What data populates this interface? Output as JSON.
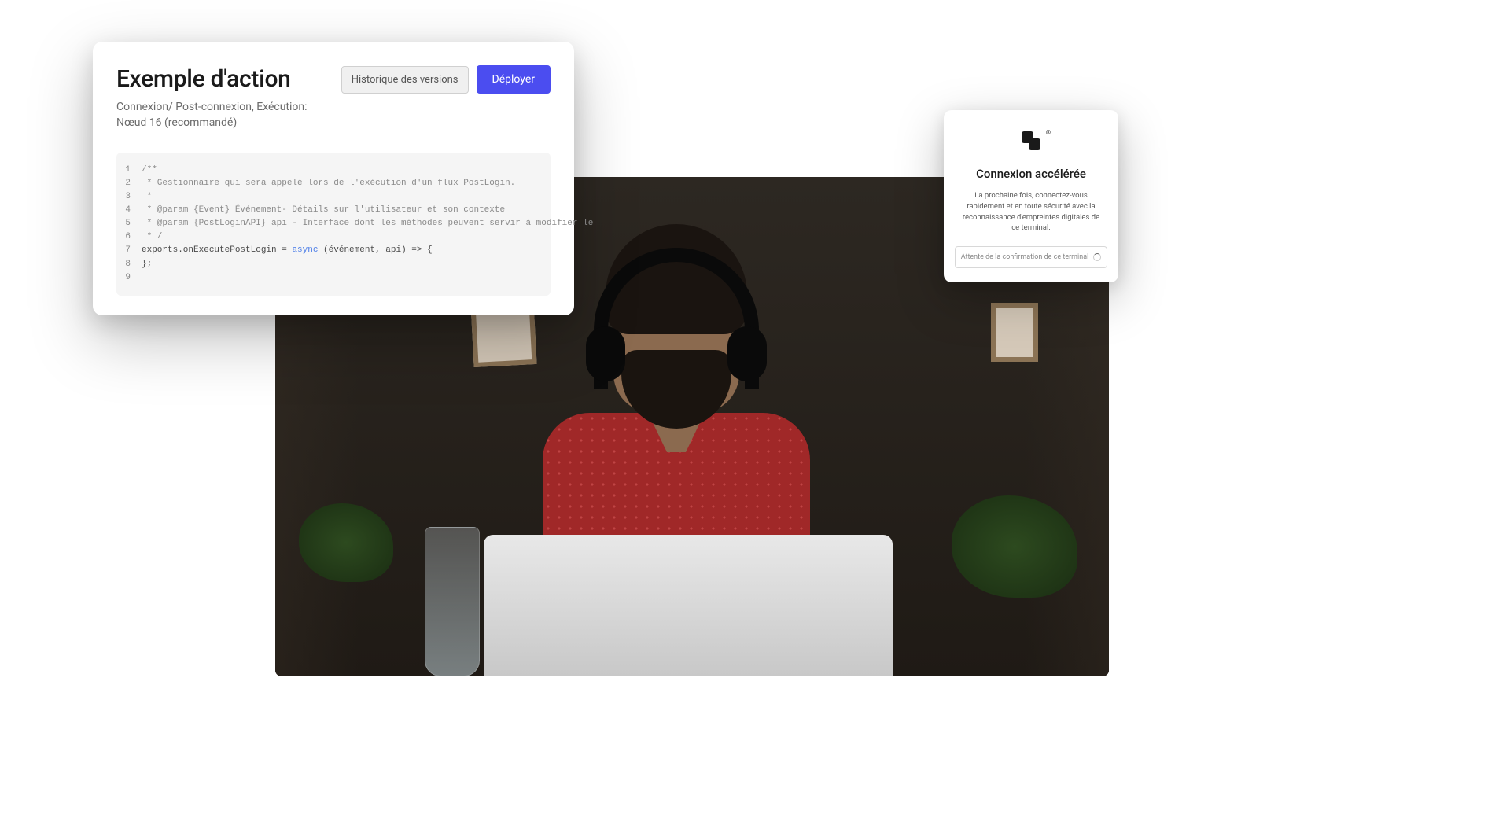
{
  "code_card": {
    "title": "Exemple d'action",
    "subtitle": "Connexion/ Post-connexion, Exécution: Nœud 16 (recommandé)",
    "buttons": {
      "history": "Historique des versions",
      "deploy": "Déployer"
    },
    "code": {
      "lines": [
        {
          "num": "1",
          "segments": [
            {
              "t": "/**",
              "c": "comment"
            }
          ]
        },
        {
          "num": "2",
          "segments": [
            {
              "t": " * Gestionnaire qui sera appelé lors de l'exécution d'un flux PostLogin.",
              "c": "comment"
            }
          ]
        },
        {
          "num": "3",
          "segments": [
            {
              "t": " *",
              "c": "comment"
            }
          ]
        },
        {
          "num": "4",
          "segments": [
            {
              "t": " * @param {Event} Événement- Détails sur l'utilisateur et son contexte",
              "c": "comment"
            }
          ]
        },
        {
          "num": "5",
          "segments": [
            {
              "t": " * @param {PostLoginAPI} api - Interface dont les méthodes peuvent servir à modifier le",
              "c": "comment"
            }
          ]
        },
        {
          "num": "6",
          "segments": [
            {
              "t": " * /",
              "c": "comment"
            }
          ]
        },
        {
          "num": "7",
          "segments": [
            {
              "t": "exports.onExecutePostLogin = ",
              "c": "plain"
            },
            {
              "t": "async",
              "c": "keyword"
            },
            {
              "t": " (événement, api) => {",
              "c": "plain"
            }
          ]
        },
        {
          "num": "8",
          "segments": [
            {
              "t": "};",
              "c": "plain"
            }
          ]
        },
        {
          "num": "9",
          "segments": [
            {
              "t": "",
              "c": "plain"
            }
          ]
        }
      ]
    }
  },
  "login_card": {
    "title": "Connexion accélérée",
    "text": "La prochaine fois, connectez-vous rapidement et en toute sécurité avec la reconnaissance d'empreintes digitales de ce terminal.",
    "status": "Attente de la confirmation de ce terminal",
    "logo_reg": "®"
  }
}
